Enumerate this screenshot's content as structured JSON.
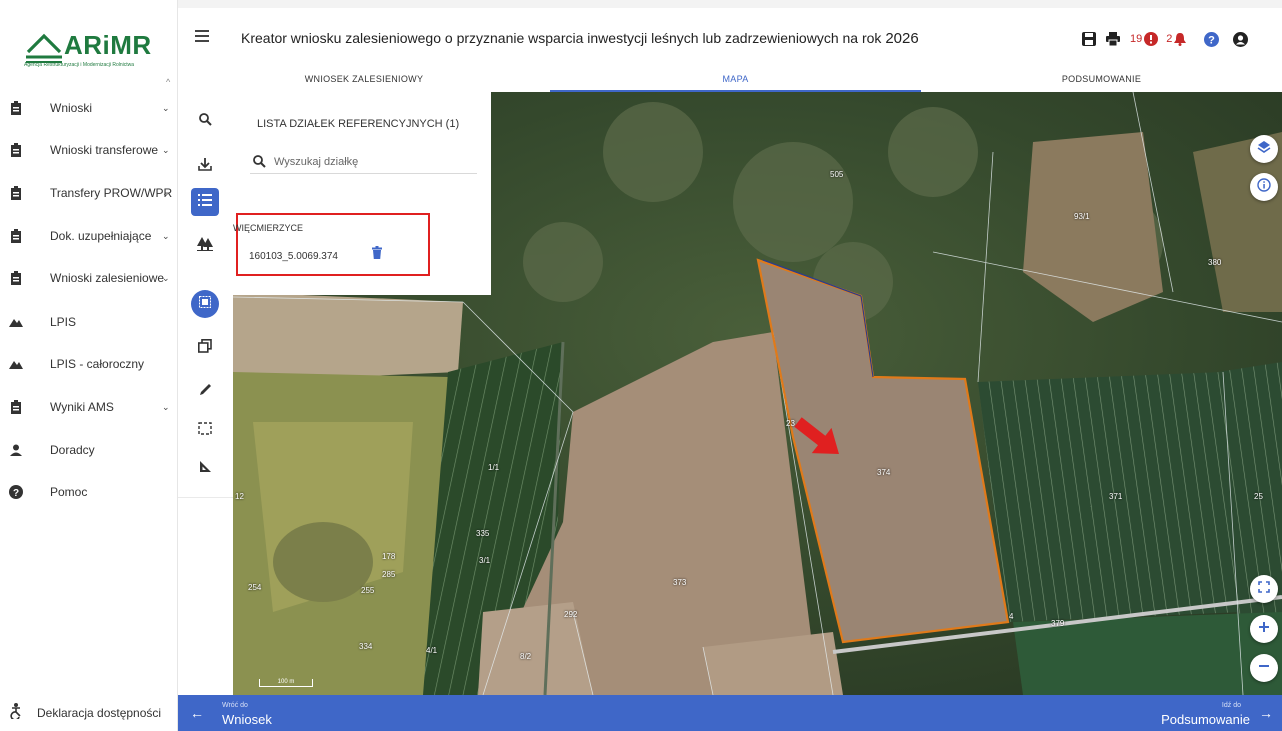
{
  "app": {
    "logo_text": "ARiMR",
    "logo_subtitle": "Agencja Restrukturyzacji i Modernizacji Rolnictwa",
    "title": "Kreator wniosku zalesieniowego o przyznanie wsparcia inwestycji leśnych lub zadrzewieniowych na rok",
    "year": "2026"
  },
  "header": {
    "error_count": "19",
    "notification_count": "2"
  },
  "tabs": [
    {
      "label": "WNIOSEK ZALESIENIOWY",
      "active": false
    },
    {
      "label": "MAPA",
      "active": true
    },
    {
      "label": "PODSUMOWANIE",
      "active": false
    }
  ],
  "sidebar": {
    "items": [
      {
        "label": "Wnioski",
        "icon": "clipboard-icon",
        "expandable": true
      },
      {
        "label": "Wnioski transferowe",
        "icon": "clipboard-icon",
        "expandable": true
      },
      {
        "label": "Transfery PROW/WPR",
        "icon": "clipboard-icon",
        "expandable": true
      },
      {
        "label": "Dok. uzupełniające",
        "icon": "clipboard-icon",
        "expandable": true
      },
      {
        "label": "Wnioski zalesieniowe",
        "icon": "clipboard-icon",
        "expandable": true
      },
      {
        "label": "LPIS",
        "icon": "terrain-icon",
        "expandable": false
      },
      {
        "label": "LPIS - całoroczny",
        "icon": "terrain-icon",
        "expandable": false
      },
      {
        "label": "Wyniki AMS",
        "icon": "clipboard-icon",
        "expandable": true
      },
      {
        "label": "Doradcy",
        "icon": "person-icon",
        "expandable": false
      },
      {
        "label": "Pomoc",
        "icon": "help-icon",
        "expandable": false
      }
    ],
    "footer_link": "Deklaracja dostępności"
  },
  "panel": {
    "title": "LISTA DZIAŁEK REFERENCYJNYCH (1)",
    "search_placeholder": "Wyszukaj działkę",
    "group_name": "WIĘCMIERZYCE",
    "parcels": [
      "160103_5.0069.374"
    ]
  },
  "map": {
    "parcel_labels": [
      "505",
      "93/1",
      "380",
      "23",
      "374",
      "1/1",
      "335",
      "3/1",
      "178",
      "285",
      "255",
      "254",
      "12",
      "373",
      "292",
      "334",
      "4/1",
      "8/2",
      "371",
      "25",
      "379",
      "4"
    ],
    "scale_label": "100 m",
    "selected_parcel": "374"
  },
  "footer": {
    "back_hint": "Wróć do",
    "back_label": "Wniosek",
    "next_hint": "Idź do",
    "next_label": "Podsumowanie"
  },
  "colors": {
    "primary": "#3f67c8",
    "brand": "#1f7a3f",
    "highlight": "#e02020",
    "parcel_outline": "#e07a1a",
    "error": "#c62828"
  }
}
